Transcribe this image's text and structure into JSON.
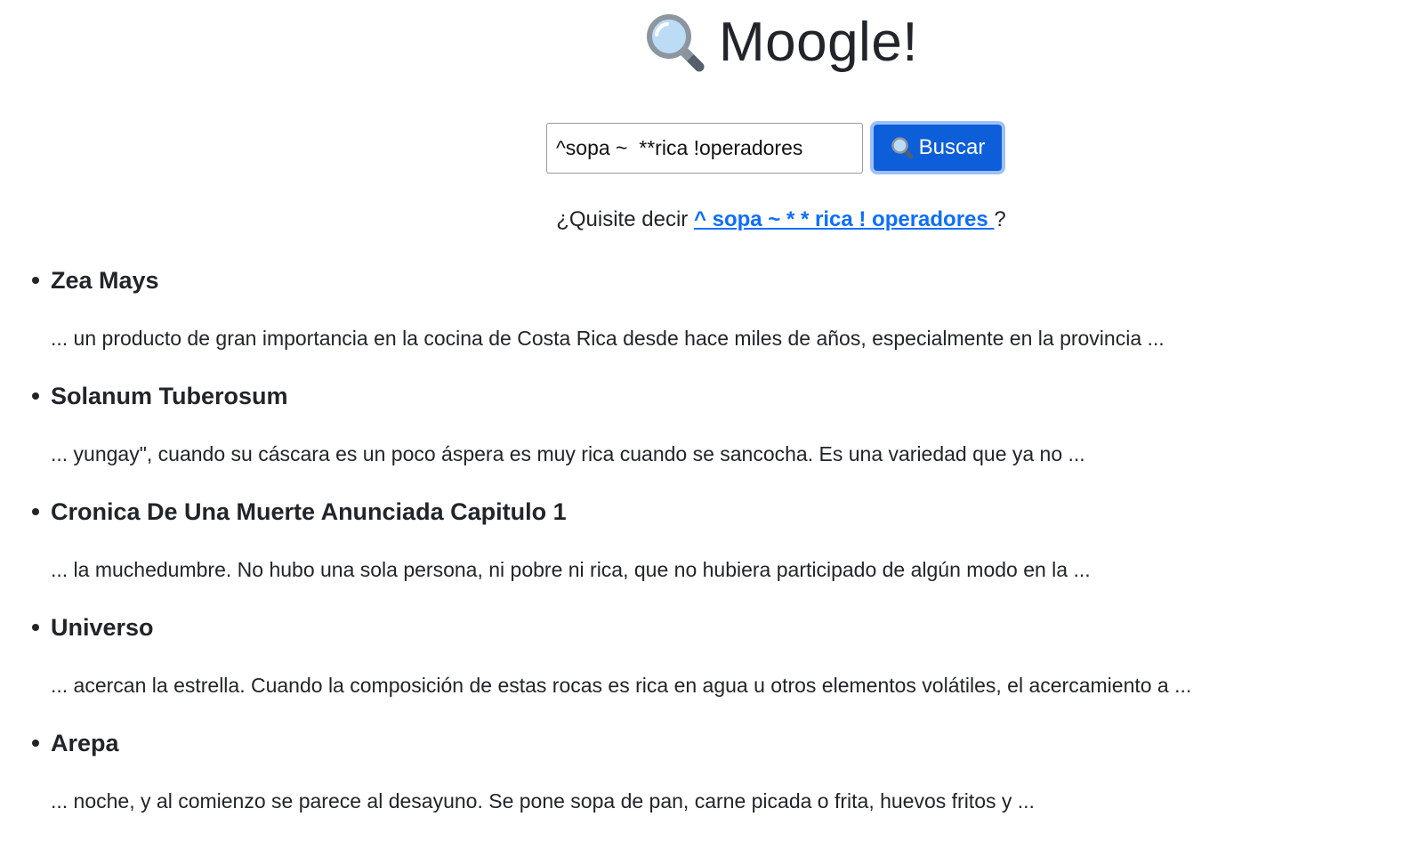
{
  "header": {
    "icon": "magnifying-glass-icon",
    "title": "Moogle!"
  },
  "search": {
    "value": "^sopa ~  **rica !operadores",
    "button_icon": "magnifying-glass-icon",
    "button_label": "Buscar"
  },
  "suggestion": {
    "prefix": "¿Quisite decir ",
    "link": "^ sopa ~ * * rica ! operadores ",
    "suffix": "?"
  },
  "results": [
    {
      "title": "Zea Mays",
      "snippet": "... un producto de gran importancia en la cocina de Costa Rica desde hace miles de años, especialmente en la provincia ..."
    },
    {
      "title": "Solanum Tuberosum",
      "snippet": "... yungay\", cuando su cáscara es un poco áspera es muy rica cuando se sancocha. Es una variedad que ya no ..."
    },
    {
      "title": "Cronica De Una Muerte Anunciada Capitulo 1",
      "snippet": "... la muchedumbre. No hubo una sola persona, ni pobre ni rica, que no hubiera participado de algún modo en la ..."
    },
    {
      "title": "Universo",
      "snippet": "... acercan la estrella. Cuando la composición de estas rocas es rica en agua u otros elementos volátiles, el acercamiento a ..."
    },
    {
      "title": "Arepa",
      "snippet": "... noche, y al comienzo se parece al desayuno. Se pone sopa de pan, carne picada o frita, huevos fritos y ..."
    }
  ],
  "colors": {
    "button_bg": "#0d5fd9",
    "button_ring": "#9ec0f7",
    "link": "#0d6efd",
    "text": "#212529"
  }
}
